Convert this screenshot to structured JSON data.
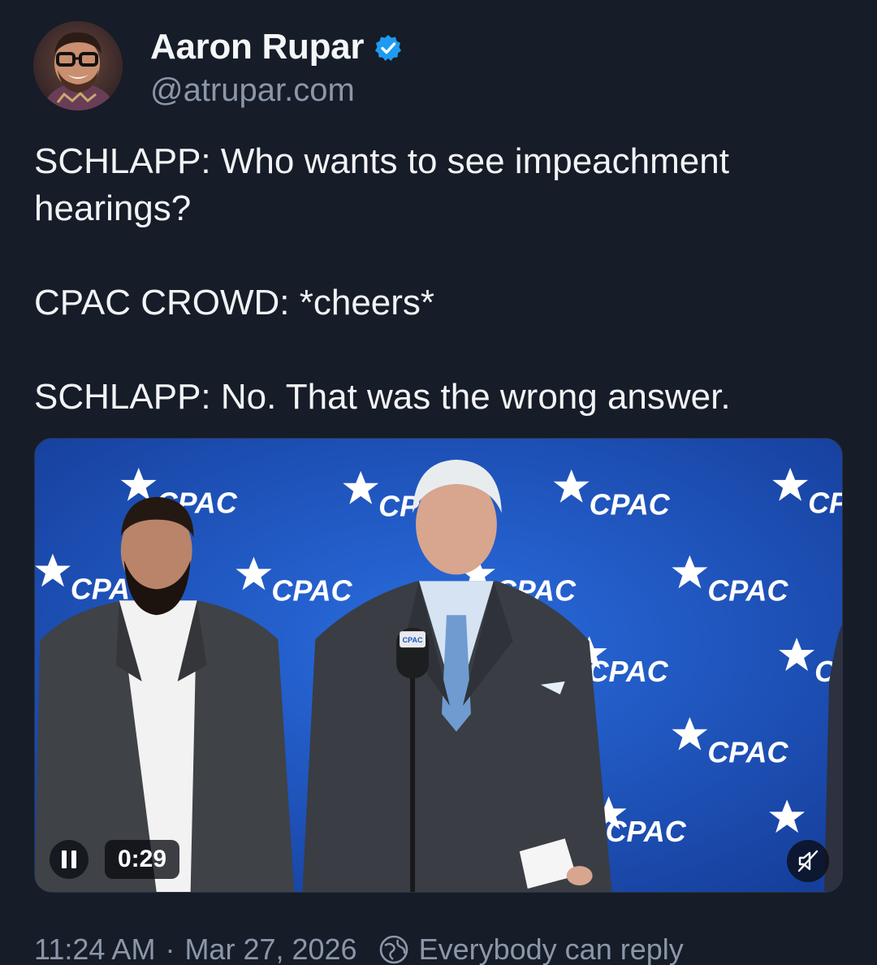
{
  "author": {
    "display_name": "Aaron Rupar",
    "handle": "@atrupar.com",
    "verified": true,
    "avatar": "avatar-photo"
  },
  "post": {
    "lines": [
      "SCHLAPP: Who wants to see impeachment hearings?",
      "CPAC CROWD: *cheers*",
      "SCHLAPP: No. That was the wrong answer."
    ]
  },
  "media": {
    "type": "video",
    "backdrop_text": "CPAC",
    "lectern_badge": "CPAC",
    "playback_state": "playing",
    "pause_icon": "pause-icon",
    "elapsed": "0:29",
    "muted": true,
    "mute_icon": "muted-speaker-icon"
  },
  "meta": {
    "time": "11:24 AM",
    "separator": "·",
    "date": "Mar 27, 2026",
    "reply_icon": "everybody-can-reply-icon",
    "reply_setting": "Everybody can reply"
  },
  "colors": {
    "background": "#161c28",
    "text": "#f1f3f5",
    "muted_text": "#8b97a8",
    "verified": "#1d9bf0",
    "backdrop": "#1b57c2"
  }
}
